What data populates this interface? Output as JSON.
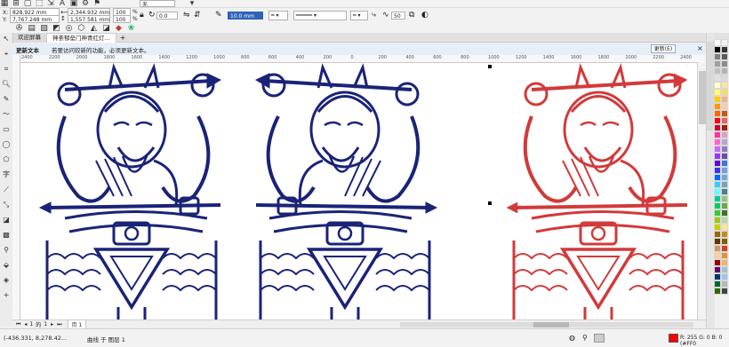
{
  "property_bar": {
    "x_value": "828.922 mm",
    "y_value": "7,767.248 mm",
    "width_value": "2,344.932 mm",
    "height_value": "1,557.581 mm",
    "scale_w": "100",
    "scale_h": "100",
    "scale_unit": "%",
    "rotation_value": "0.0",
    "outline_width": "10.0 mm",
    "zoom_preset": "50",
    "x_label": "X:",
    "y_label": "Y:",
    "top_dropdown": "无"
  },
  "tabs": {
    "welcome": "欢迎屏幕",
    "document": "神荼郁垒门神青红灯...",
    "add": "+"
  },
  "notification": {
    "title": "更新文本",
    "message": "若要访问较新的功能，必须更新文本。",
    "button": "更新(E)",
    "close": "×"
  },
  "ruler": {
    "ticks": [
      "2400",
      "2200",
      "2000",
      "1800",
      "1600",
      "1400",
      "1200",
      "1000",
      "800",
      "600",
      "400",
      "200",
      "0",
      "200",
      "400",
      "600",
      "800",
      "1000",
      "1200",
      "1400",
      "1600",
      "1800",
      "2000",
      "2200",
      "2400"
    ]
  },
  "page_nav": {
    "current": "1",
    "of": "的",
    "total": "1",
    "page_label": "页 1"
  },
  "status_bar": {
    "coordinates": "(-436.331, 8,278.42...",
    "selection_info": "曲线 于 图层 1",
    "fill_info": "R: 255 G: 0 B: 0 (#FF0",
    "fill_color": "#ff0000"
  },
  "colors": {
    "guardian_blue": "#1a2377",
    "guardian_red": "#d23a3a",
    "canvas_bg": "#ffffff",
    "notification_bg": "#e6eef7",
    "accent": "#2c64b8"
  },
  "palette": {
    "column_a": [
      "#ffffff",
      "#000000",
      "#7f7f7f",
      "#a0a0a0",
      "#c0c0c0",
      "#e0e0e0",
      "#ffffcc",
      "#ffff66",
      "#ffcc00",
      "#ff9900",
      "#ff6600",
      "#ff0000",
      "#cc0033",
      "#ff3399",
      "#ff66cc",
      "#cc66ff",
      "#9933ff",
      "#6600cc",
      "#3333ff",
      "#0066ff",
      "#33ccff",
      "#66ffff",
      "#00cc99",
      "#00cc66",
      "#33cc33",
      "#99cc00",
      "#cccc00",
      "#996600",
      "#663300",
      "#cc9966",
      "#ffcc99",
      "#990000",
      "#660066",
      "#003366",
      "#006633",
      "#336600"
    ],
    "column_b": [
      "#f2f2f2",
      "#333333",
      "#595959",
      "#8c8c8c",
      "#b3b3b3",
      "#d9d9d9",
      "#ffe699",
      "#ffd966",
      "#f4b183",
      "#f8cbad",
      "#c65911",
      "#e06666",
      "#a61c00",
      "#d5a6bd",
      "#b4a7d6",
      "#8e7cc3",
      "#674ea7",
      "#3c78d8",
      "#6d9eeb",
      "#6fa8dc",
      "#76a5af",
      "#45818e",
      "#93c47d",
      "#6aa84f",
      "#38761d",
      "#b6d7a8",
      "#ffe599",
      "#bf9000",
      "#7f6000",
      "#cc4125",
      "#e69138",
      "#f6b26b",
      "#a2c4c9",
      "#9fc5e8",
      "#b7b7b7",
      "#434343"
    ]
  }
}
